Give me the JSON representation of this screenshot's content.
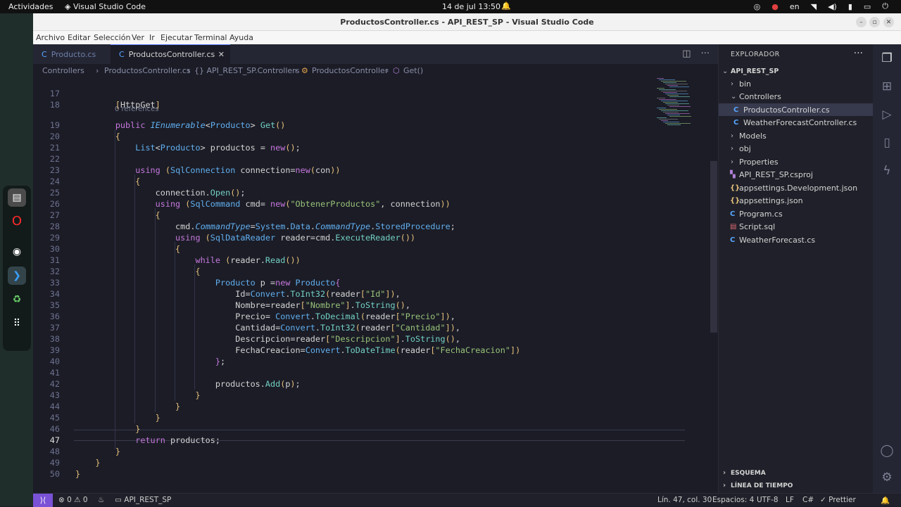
{
  "os": {
    "activities": "Actividades",
    "app_name": "Visual Studio Code",
    "clock": "14 de jul  13:50",
    "language": "en"
  },
  "window": {
    "title": "ProductosController.cs - API_REST_SP - Visual Studio Code"
  },
  "menu": [
    "Archivo",
    "Editar",
    "Selección",
    "Ver",
    "Ir",
    "Ejecutar",
    "Terminal",
    "Ayuda"
  ],
  "tabs": [
    {
      "label": "Producto.cs",
      "active": false
    },
    {
      "label": "ProductosController.cs",
      "active": true
    }
  ],
  "breadcrumb": [
    "Controllers",
    "ProductosController.cs",
    "{} API_REST_SP.Controllers",
    "ProductosController",
    "Get()"
  ],
  "editor": {
    "references_hint": "0 references",
    "cursor_line": "47",
    "lines": [
      {
        "n": "17",
        "code": ""
      },
      {
        "n": "18",
        "code": "        [HttpGet]"
      },
      {
        "n": "19",
        "code": "        public IEnumerable<Producto> Get()"
      },
      {
        "n": "20",
        "code": "        {"
      },
      {
        "n": "21",
        "code": "            List<Producto> productos = new();"
      },
      {
        "n": "22",
        "code": ""
      },
      {
        "n": "23",
        "code": "            using (SqlConnection connection=new(con))"
      },
      {
        "n": "24",
        "code": "            {"
      },
      {
        "n": "25",
        "code": "                connection.Open();"
      },
      {
        "n": "26",
        "code": "                using (SqlCommand cmd= new(\"ObtenerProductos\", connection))"
      },
      {
        "n": "27",
        "code": "                {"
      },
      {
        "n": "28",
        "code": "                    cmd.CommandType=System.Data.CommandType.StoredProcedure;"
      },
      {
        "n": "29",
        "code": "                    using (SqlDataReader reader=cmd.ExecuteReader())"
      },
      {
        "n": "30",
        "code": "                    {"
      },
      {
        "n": "31",
        "code": "                        while (reader.Read())"
      },
      {
        "n": "32",
        "code": "                        {"
      },
      {
        "n": "33",
        "code": "                            Producto p =new Producto{"
      },
      {
        "n": "34",
        "code": "                                Id=Convert.ToInt32(reader[\"Id\"]),"
      },
      {
        "n": "35",
        "code": "                                Nombre=reader[\"Nombre\"].ToString(),"
      },
      {
        "n": "36",
        "code": "                                Precio= Convert.ToDecimal(reader[\"Precio\"]),"
      },
      {
        "n": "37",
        "code": "                                Cantidad=Convert.ToInt32(reader[\"Cantidad\"]),"
      },
      {
        "n": "38",
        "code": "                                Descripcion=reader[\"Descripcion\"].ToString(),"
      },
      {
        "n": "39",
        "code": "                                FechaCreacion=Convert.ToDateTime(reader[\"FechaCreacion\"])"
      },
      {
        "n": "40",
        "code": "                            };"
      },
      {
        "n": "41",
        "code": ""
      },
      {
        "n": "42",
        "code": "                            productos.Add(p);"
      },
      {
        "n": "43",
        "code": "                        }"
      },
      {
        "n": "44",
        "code": "                    }"
      },
      {
        "n": "45",
        "code": "                }"
      },
      {
        "n": "46",
        "code": "            }"
      },
      {
        "n": "47",
        "code": "            return productos;"
      },
      {
        "n": "48",
        "code": "        }"
      },
      {
        "n": "49",
        "code": "    }"
      },
      {
        "n": "50",
        "code": "}"
      }
    ]
  },
  "explorer": {
    "title": "EXPLORADOR",
    "root": "API_REST_SP",
    "items": [
      {
        "label": "bin",
        "type": "folder"
      },
      {
        "label": "Controllers",
        "type": "folder-open"
      },
      {
        "label": "ProductosController.cs",
        "type": "cs",
        "selected": true
      },
      {
        "label": "WeatherForecastController.cs",
        "type": "cs"
      },
      {
        "label": "Models",
        "type": "folder"
      },
      {
        "label": "obj",
        "type": "folder"
      },
      {
        "label": "Properties",
        "type": "folder"
      },
      {
        "label": "API_REST_SP.csproj",
        "type": "csproj"
      },
      {
        "label": "appsettings.Development.json",
        "type": "json"
      },
      {
        "label": "appsettings.json",
        "type": "json"
      },
      {
        "label": "Program.cs",
        "type": "cs-root"
      },
      {
        "label": "Script.sql",
        "type": "sql"
      },
      {
        "label": "WeatherForecast.cs",
        "type": "cs-root"
      }
    ],
    "outline": "ESQUEMA",
    "timeline": "LÍNEA DE TIEMPO"
  },
  "status": {
    "problems": "⊗ 0 ⚠ 0",
    "project": "API_REST_SP",
    "position": "Lín. 47, col. 30",
    "spaces": "Espacios: 4",
    "encoding": "UTF-8",
    "eol": "LF",
    "language": "C#",
    "formatter": "Prettier"
  },
  "colors": {
    "accent": "#7a52d6",
    "keyword": "#c678dd",
    "type": "#61afef",
    "string": "#98c379",
    "method": "#73d0c4"
  }
}
